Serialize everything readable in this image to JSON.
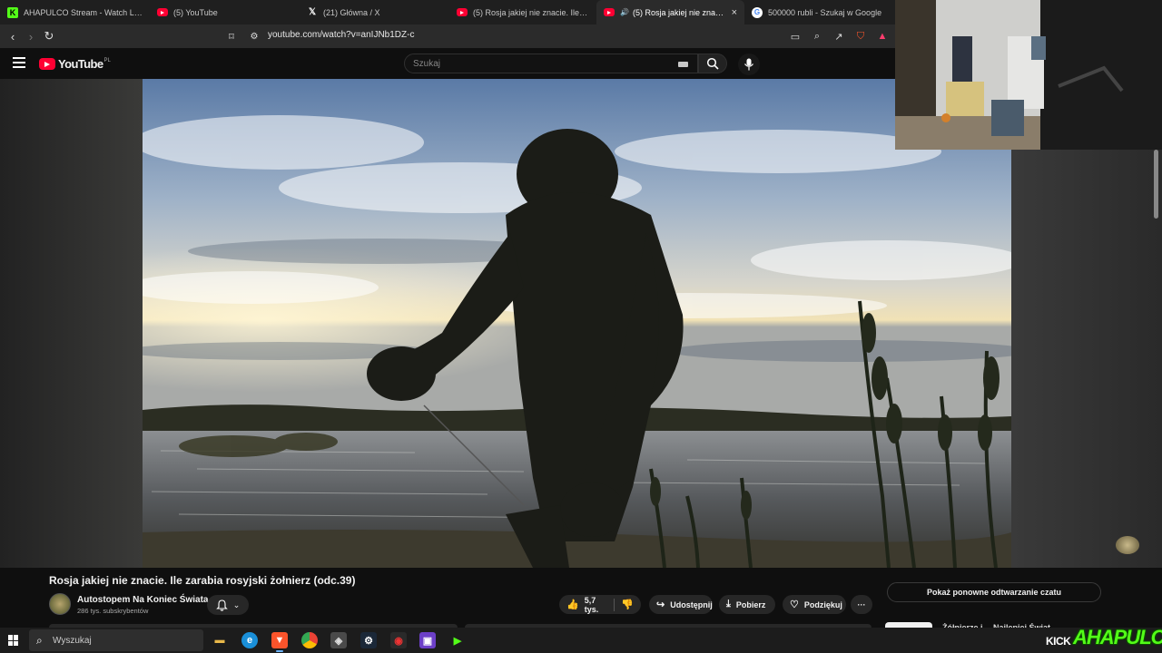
{
  "browser": {
    "tabs": [
      {
        "title": "AHAPULCO Stream - Watch Live on K",
        "icon": "kick-icon"
      },
      {
        "title": "(5) YouTube",
        "icon": "youtube-icon"
      },
      {
        "title": "(21) Główna / X",
        "icon": "x-icon"
      },
      {
        "title": "(5) Rosja jakiej nie znacie. Ile zarabia",
        "icon": "youtube-icon"
      },
      {
        "title": "(5) Rosja jakiej nie znacie. Ile",
        "icon": "youtube-icon",
        "active": true
      },
      {
        "title": "500000 rubli - Szukaj w Google",
        "icon": "google-icon"
      }
    ],
    "close_glyph": "×",
    "url": "youtube.com/watch?v=anIJNb1DZ-c"
  },
  "youtube": {
    "logo_text": "YouTube",
    "country_code": "PL",
    "search_placeholder": "Szukaj"
  },
  "video": {
    "title": "Rosja jakiej nie znacie. Ile zarabia rosyjski żołnierz (odc.39)",
    "channel_name": "Autostopem Na Koniec Świata",
    "subscribers": "286 tys. subskrybentów",
    "likes": "5,7 tys.",
    "share_label": "Udostępnij",
    "download_label": "Pobierz",
    "thanks_label": "Podziękuj",
    "more_label": "···",
    "replay_chat_label": "Pokaż ponowne odtwarzanie czatu",
    "partial_chip_text": "Żółnierze i… Najlepiej Świat"
  },
  "taskbar": {
    "search_label": "Wyszukaj"
  },
  "overlay": {
    "kick_text": "KICK",
    "streamer_text": "AHAPULCO"
  },
  "colors": {
    "youtube_red": "#ff0033",
    "kick_green": "#53fc18",
    "background": "#0f0f0f"
  }
}
